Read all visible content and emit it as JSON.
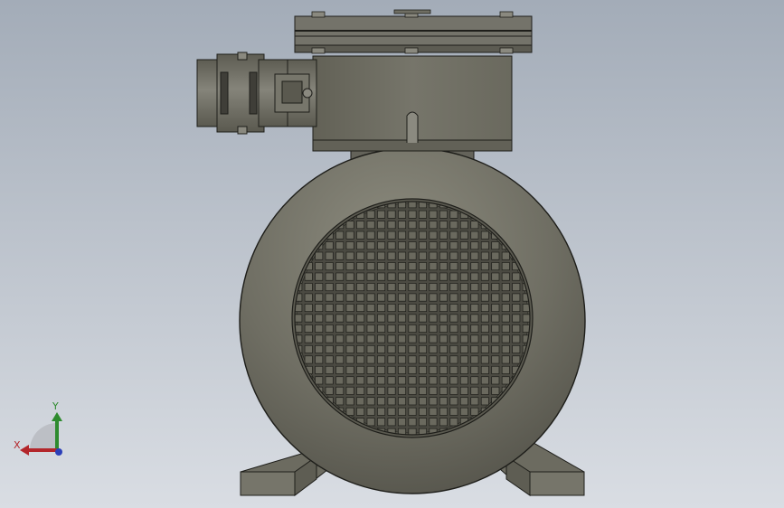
{
  "viewport": {
    "background_top": "#a3acb8",
    "background_bottom": "#d9dde3",
    "model_color": "#6f6e63",
    "model_dark": "#4f4e45",
    "edge_color": "#1e1e1a"
  },
  "model": {
    "name": "electric-motor-front-view",
    "grille": {
      "rows": 23,
      "cols": 23
    }
  },
  "triad": {
    "x_label": "X",
    "y_label": "Y",
    "x_color": "#b3262b",
    "y_color": "#2e8b2e",
    "z_color": "#2b3fb8"
  }
}
